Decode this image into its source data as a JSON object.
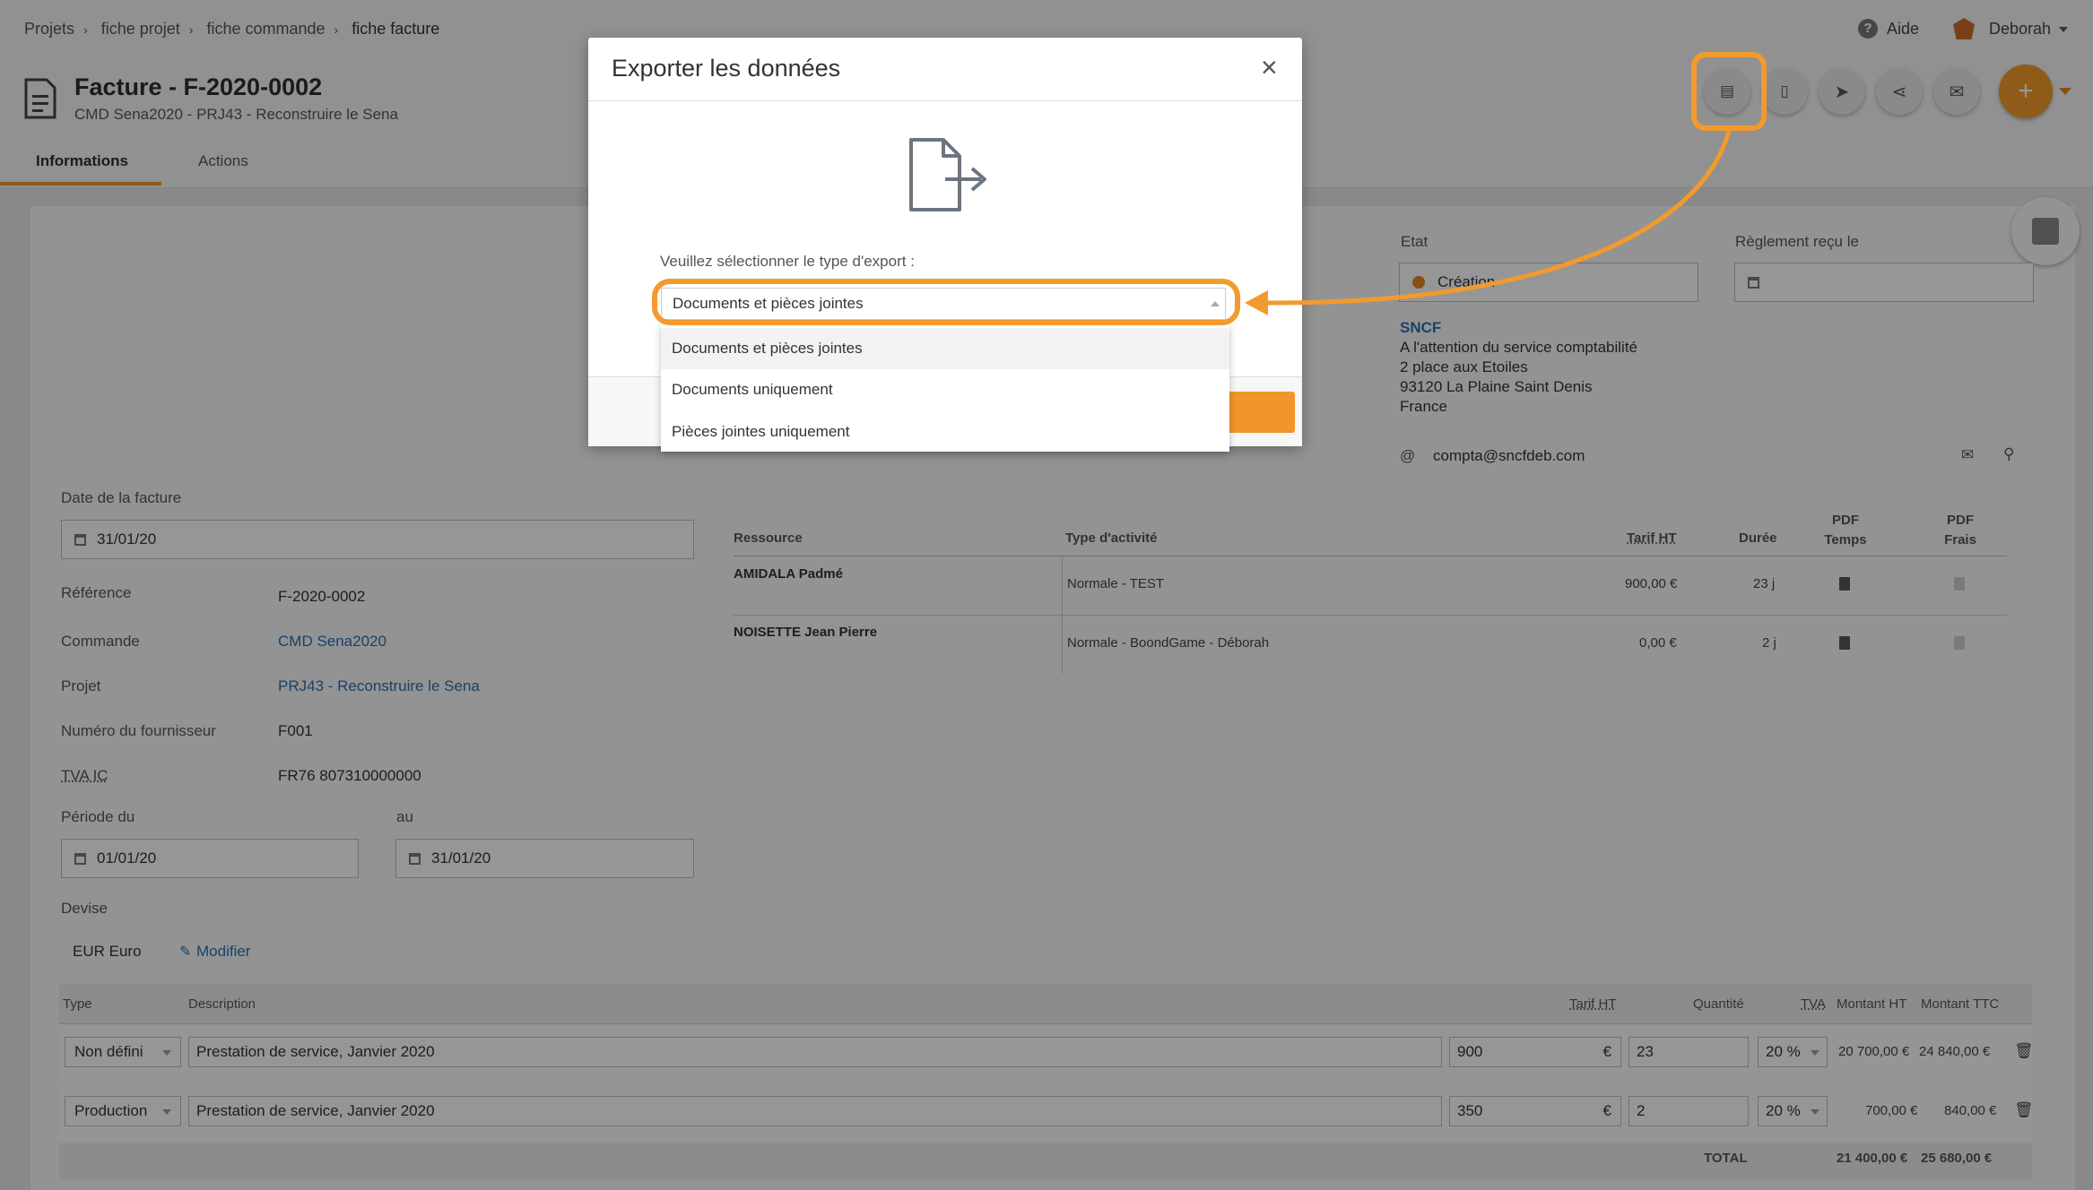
{
  "breadcrumb": [
    "Projets",
    "fiche projet",
    "fiche commande",
    "fiche facture"
  ],
  "header": {
    "title": "Facture - F-2020-0002",
    "subtitle": "CMD Sena2020 - PRJ43 - Reconstruire le Sena",
    "help": "Aide",
    "user": "Deborah",
    "plus": "+"
  },
  "tabs": [
    "Informations",
    "Actions"
  ],
  "state": {
    "etat_label": "Etat",
    "etat_value": "Création",
    "reglement_label": "Règlement reçu le",
    "reglement_value": ""
  },
  "address": {
    "company": "SNCF",
    "lines": [
      "A l'attention du service comptabilité",
      "2 place aux Etoiles",
      "93120 La Plaine Saint Denis",
      "France"
    ],
    "email": "compta@sncfdeb.com"
  },
  "form": {
    "date_label": "Date de la facture",
    "date_value": "31/01/20",
    "reference_label": "Référence",
    "reference_value": "F-2020-0002",
    "commande_label": "Commande",
    "commande_value": "CMD Sena2020",
    "projet_label": "Projet",
    "projet_value": "PRJ43 - Reconstruire le Sena",
    "fournisseur_label": "Numéro du fournisseur",
    "fournisseur_value": "F001",
    "tva_label": "TVA IC",
    "tva_value": "FR76 807310000000",
    "periode_label": "Période du",
    "periode_from": "01/01/20",
    "au_label": "au",
    "periode_to": "31/01/20",
    "devise_label": "Devise",
    "devise_value": "EUR Euro",
    "modifier": "Modifier"
  },
  "resources": {
    "headers": [
      "Ressource",
      "Type d'activité",
      "Tarif HT",
      "Durée",
      "PDF Temps",
      "PDF Frais"
    ],
    "rows": [
      {
        "name": "AMIDALA Padmé",
        "type": "Normale - TEST",
        "tarif": "900,00 €",
        "duree": "23 j"
      },
      {
        "name": "NOISETTE Jean Pierre",
        "type": "Normale - BoondGame - Déborah",
        "tarif": "0,00 €",
        "duree": "2 j"
      }
    ]
  },
  "lines": {
    "headers": [
      "Type",
      "Description",
      "Tarif HT",
      "Quantité",
      "TVA",
      "Montant HT",
      "Montant TTC"
    ],
    "rows": [
      {
        "type": "Non défini",
        "description": "Prestation de service, Janvier 2020",
        "tarif": "900",
        "qty": "23",
        "tva": "20 %",
        "ht": "20 700,00 €",
        "ttc": "24 840,00 €"
      },
      {
        "type": "Production",
        "description": "Prestation de service, Janvier 2020",
        "tarif": "350",
        "qty": "2",
        "tva": "20 %",
        "ht": "700,00 €",
        "ttc": "840,00 €"
      }
    ],
    "total_label": "TOTAL",
    "total_ht": "21 400,00 €",
    "total_ttc": "25 680,00 €",
    "currency": "€"
  },
  "modal": {
    "title": "Exporter les données",
    "close": "×",
    "prompt": "Veuillez sélectionner le type d'export :",
    "selected": "Documents et pièces jointes",
    "options": [
      "Documents et pièces jointes",
      "Documents uniquement",
      "Pièces jointes uniquement"
    ]
  },
  "colors": {
    "accent": "#f0962a",
    "link": "#2a6fb0",
    "highlight": "#f29a2e"
  }
}
